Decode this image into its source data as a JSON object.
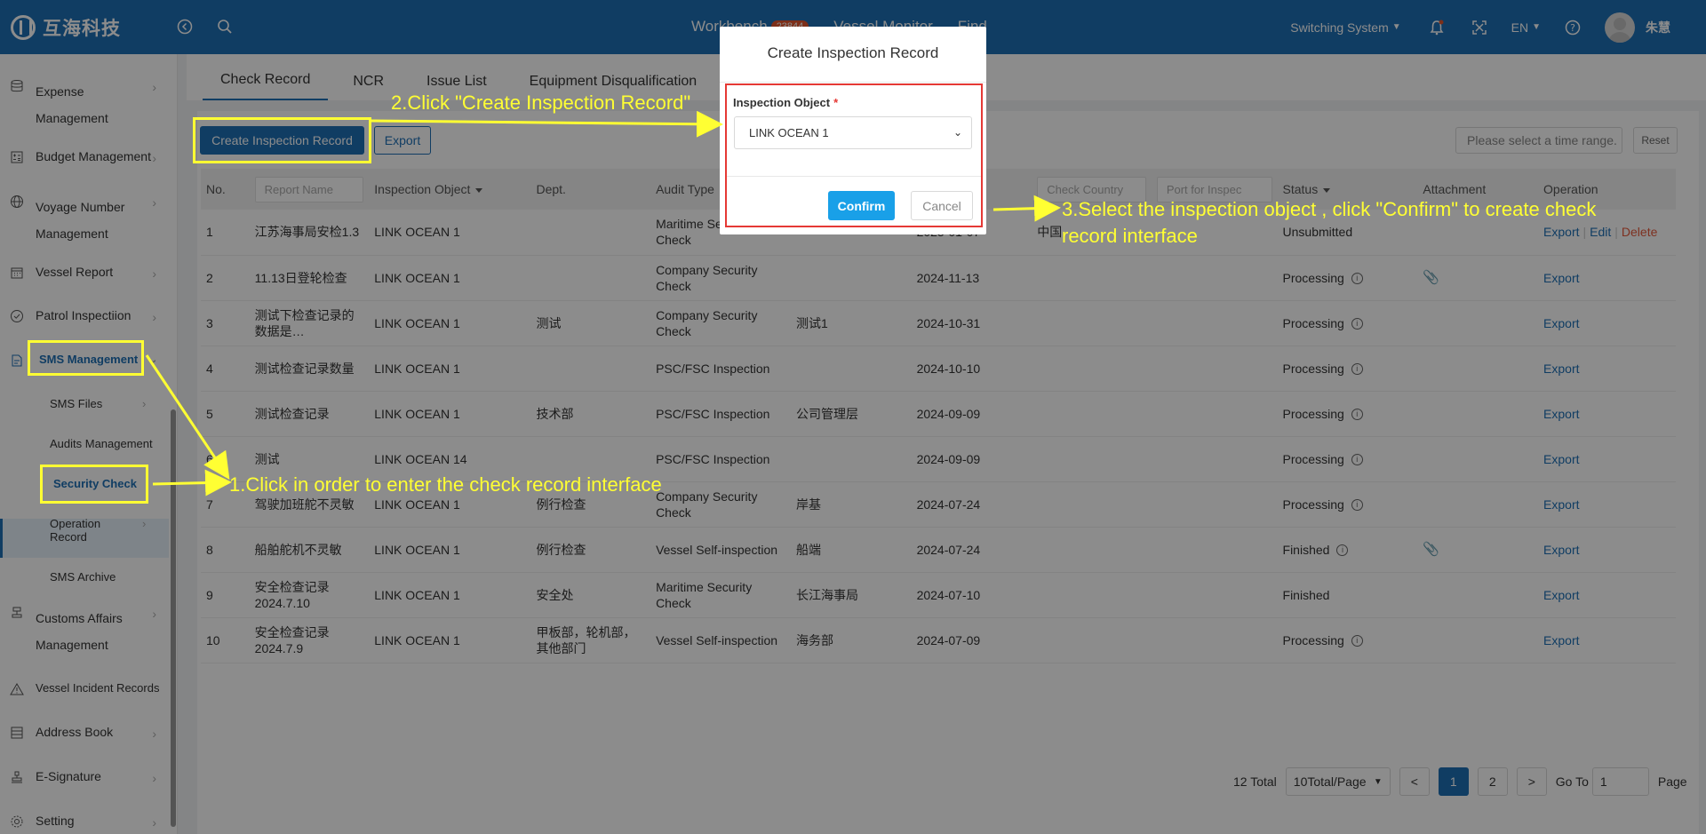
{
  "header": {
    "logo_text": "互海科技",
    "nav": [
      {
        "label": "Workbench",
        "badge": "23844"
      },
      {
        "label": "Vessel Monitor"
      },
      {
        "label": "Find"
      }
    ],
    "switching_system": "Switching System",
    "language": "EN",
    "user_name": "朱慧"
  },
  "sidebar": {
    "items": [
      {
        "label": "Expense",
        "label2": "Management",
        "icon": "database-icon"
      },
      {
        "label": "Budget Management",
        "icon": "calculator-icon"
      },
      {
        "label": "Voyage Number",
        "label2": "Management",
        "icon": "globe-icon"
      },
      {
        "label": "Vessel Report",
        "icon": "calendar-icon"
      },
      {
        "label": "Patrol Inspectiion",
        "icon": "check-circle-icon"
      },
      {
        "label": "SMS Management",
        "icon": "sms-icon"
      },
      {
        "label": "Customs Affairs",
        "label2": "Management",
        "icon": "stamp-icon"
      },
      {
        "label": "Vessel Incident Records",
        "icon": "warning-icon"
      },
      {
        "label": "Address Book",
        "icon": "addressbook-icon"
      },
      {
        "label": "E-Signature",
        "icon": "signature-icon"
      },
      {
        "label": "Setting",
        "icon": "gear-icon"
      }
    ],
    "sub_items": [
      {
        "label": "SMS Files"
      },
      {
        "label": "Audits Management"
      },
      {
        "label": "Security Check"
      },
      {
        "label": "Operation",
        "label2": "Record"
      },
      {
        "label": "SMS Archive"
      }
    ]
  },
  "tabs": [
    "Check Record",
    "NCR",
    "Issue List",
    "Equipment Disqualification"
  ],
  "toolbar": {
    "create_label": "Create Inspection Record",
    "export_label": "Export",
    "time_placeholder": "Please select a time range.",
    "reset_label": "Reset"
  },
  "table": {
    "headers": {
      "no": "No.",
      "report_name": "Report Name",
      "inspection_object": "Inspection Object",
      "dept": "Dept.",
      "audit_type": "Audit Type",
      "check_country": "Check Country",
      "port": "Port for Inspec",
      "status": "Status",
      "attachment": "Attachment",
      "operation": "Operation"
    },
    "rows": [
      {
        "no": "1",
        "name": "江苏海事局安检1.3",
        "object": "LINK OCEAN 1",
        "dept": "",
        "type": "Maritime Security Check",
        "org": "",
        "date": "2025-01-07",
        "country": "中国",
        "status": "Unsubmitted",
        "info": false,
        "attach": false,
        "ops": [
          "Export",
          "Edit",
          "Delete"
        ]
      },
      {
        "no": "2",
        "name": "11.13日登轮检查",
        "object": "LINK OCEAN 1",
        "dept": "",
        "type": "Company Security Check",
        "org": "",
        "date": "2024-11-13",
        "country": "",
        "status": "Processing",
        "info": true,
        "attach": true,
        "ops": [
          "Export"
        ]
      },
      {
        "no": "3",
        "name": "测试下检查记录的数据是…",
        "object": "LINK OCEAN 1",
        "dept": "测试",
        "type": "Company Security Check",
        "org": "测试1",
        "date": "2024-10-31",
        "country": "",
        "status": "Processing",
        "info": true,
        "attach": false,
        "ops": [
          "Export"
        ]
      },
      {
        "no": "4",
        "name": "测试检查记录数量",
        "object": "LINK OCEAN 1",
        "dept": "",
        "type": "PSC/FSC Inspection",
        "org": "",
        "date": "2024-10-10",
        "country": "",
        "status": "Processing",
        "info": true,
        "attach": false,
        "ops": [
          "Export"
        ]
      },
      {
        "no": "5",
        "name": "测试检查记录",
        "object": "LINK OCEAN 1",
        "dept": "技术部",
        "type": "PSC/FSC Inspection",
        "org": "公司管理层",
        "date": "2024-09-09",
        "country": "",
        "status": "Processing",
        "info": true,
        "attach": false,
        "ops": [
          "Export"
        ]
      },
      {
        "no": "6",
        "name": "测试",
        "object": "LINK OCEAN 14",
        "dept": "",
        "type": "PSC/FSC Inspection",
        "org": "",
        "date": "2024-09-09",
        "country": "",
        "status": "Processing",
        "info": true,
        "attach": false,
        "ops": [
          "Export"
        ]
      },
      {
        "no": "7",
        "name": "驾驶加班舵不灵敏",
        "object": "LINK OCEAN 1",
        "dept": "例行检查",
        "type": "Company Security Check",
        "org": "岸基",
        "date": "2024-07-24",
        "country": "",
        "status": "Processing",
        "info": true,
        "attach": false,
        "ops": [
          "Export"
        ]
      },
      {
        "no": "8",
        "name": "船舶舵机不灵敏",
        "object": "LINK OCEAN 1",
        "dept": "例行检查",
        "type": "Vessel Self-inspection",
        "org": "船端",
        "date": "2024-07-24",
        "country": "",
        "status": "Finished",
        "info": true,
        "attach": true,
        "ops": [
          "Export"
        ]
      },
      {
        "no": "9",
        "name": "安全检查记录2024.7.10",
        "object": "LINK OCEAN 1",
        "dept": "安全处",
        "type": "Maritime Security Check",
        "org": "长江海事局",
        "date": "2024-07-10",
        "country": "",
        "status": "Finished",
        "info": false,
        "attach": false,
        "ops": [
          "Export"
        ]
      },
      {
        "no": "10",
        "name": "安全检查记录2024.7.9",
        "object": "LINK OCEAN 1",
        "dept": "甲板部，轮机部，其他部门",
        "type": "Vessel Self-inspection",
        "org": "海务部",
        "date": "2024-07-09",
        "country": "",
        "status": "Processing",
        "info": true,
        "attach": false,
        "ops": [
          "Export"
        ]
      }
    ]
  },
  "pagination": {
    "total": "12 Total",
    "page_size": "10Total/Page",
    "prev": "<",
    "pages": [
      "1",
      "2"
    ],
    "next": ">",
    "goto_label": "Go To",
    "goto_value": "1",
    "page_label": "Page"
  },
  "modal": {
    "title": "Create Inspection Record",
    "field_label": "Inspection Object",
    "required_mark": "*",
    "selected_value": "LINK OCEAN 1",
    "confirm_label": "Confirm",
    "cancel_label": "Cancel"
  },
  "annotations": {
    "step1": "1.Click in order to enter the check record interface",
    "step2": "2.Click \"Create Inspection Record\"",
    "step3_line1": "3.Select the inspection object , click \"Confirm\" to create check",
    "step3_line2": "record interface"
  },
  "colors": {
    "primary": "#1e6fb5",
    "annotation": "#ffff33",
    "highlight_red": "#e53935",
    "confirm": "#19a0e8"
  }
}
